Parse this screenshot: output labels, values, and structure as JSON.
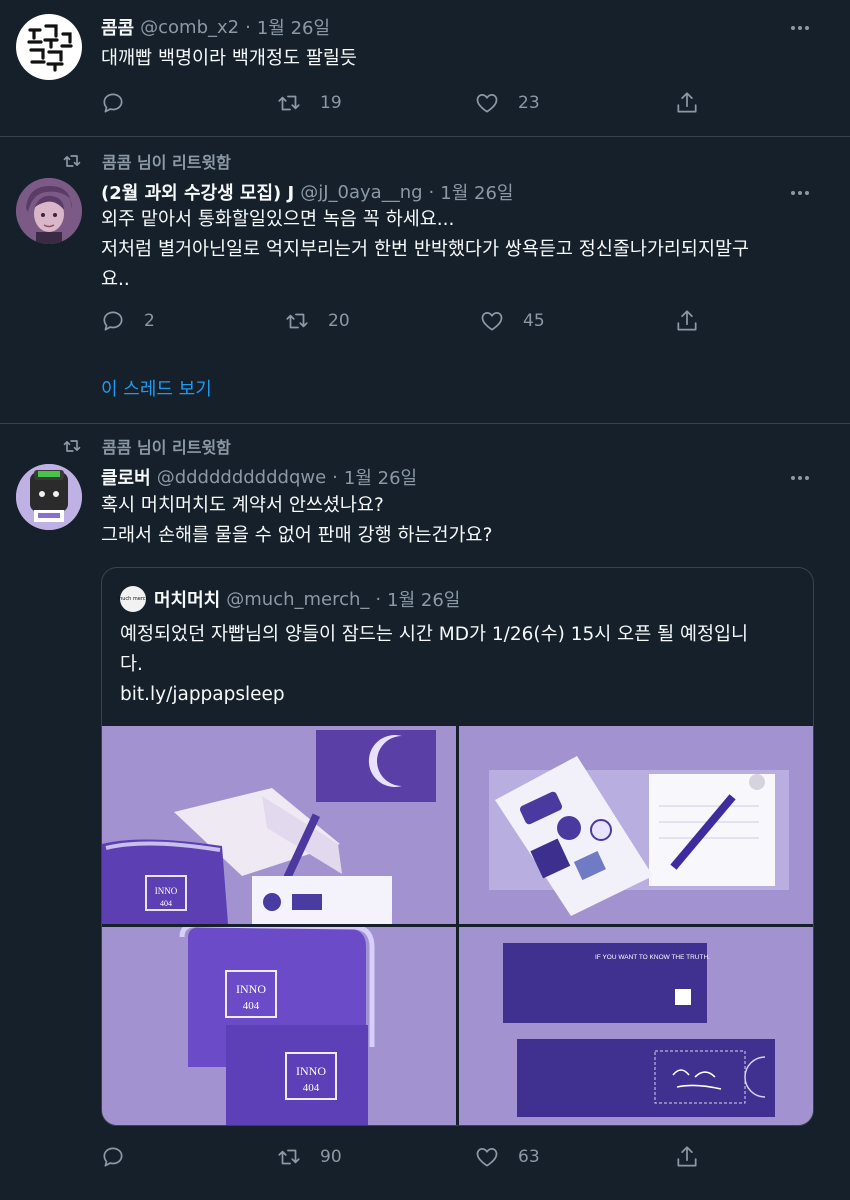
{
  "tweets": [
    {
      "name": "콤콤",
      "handle": "@comb_x2",
      "dot": "·",
      "time": "1월 26일",
      "lines": [
        "대깨빱 백명이라 백개정도 팔릴듯"
      ],
      "reply_count": "",
      "retweet_count": "19",
      "like_count": "23"
    },
    {
      "retweeted_by": "콤콤 님이 리트윗함",
      "name": "(2월 과외 수강생 모집) J",
      "handle": "@jJ_0aya__ng",
      "dot": "·",
      "time": "1월 26일",
      "lines": [
        "외주 맡아서 통화할일있으면 녹음 꼭 하세요...",
        "저처럼 별거아닌일로 억지부리는거 한번 반박했다가 쌍욕듣고 정신줄나가리되지말구",
        "요.."
      ],
      "reply_count": "2",
      "retweet_count": "20",
      "like_count": "45",
      "thread_link": "이 스레드 보기"
    },
    {
      "retweeted_by": "콤콤 님이 리트윗함",
      "name": "클로버",
      "handle": "@ddddddddddqwe",
      "dot": "·",
      "time": "1월 26일",
      "lines": [
        "혹시 머치머치도 계약서 안쓰셨나요?",
        "그래서 손해를 물을 수 없어 판매 강행 하는건가요?"
      ],
      "reply_count": "",
      "retweet_count": "90",
      "like_count": "63",
      "quote": {
        "avatar_text": "much merch",
        "name": "머치머치",
        "handle": "@much_merch_",
        "dot": "·",
        "time": "1월 26일",
        "lines": [
          "예정되었던 자빱님의 양들이 잠드는 시간 MD가 1/26(수) 15시 오픈 될 예정입니",
          "다.",
          "bit.ly/jappapsleep"
        ],
        "pouch_label_top": "INNO",
        "pouch_label_num": "404",
        "ticket_text": "IF YOU WANT TO KNOW THE TRUTH."
      }
    }
  ],
  "colors": {
    "background": "#15202b",
    "divider": "#38444d",
    "secondary_text": "#8b98a5",
    "link": "#1d9bf0",
    "image_purple": "#9f90c9"
  }
}
